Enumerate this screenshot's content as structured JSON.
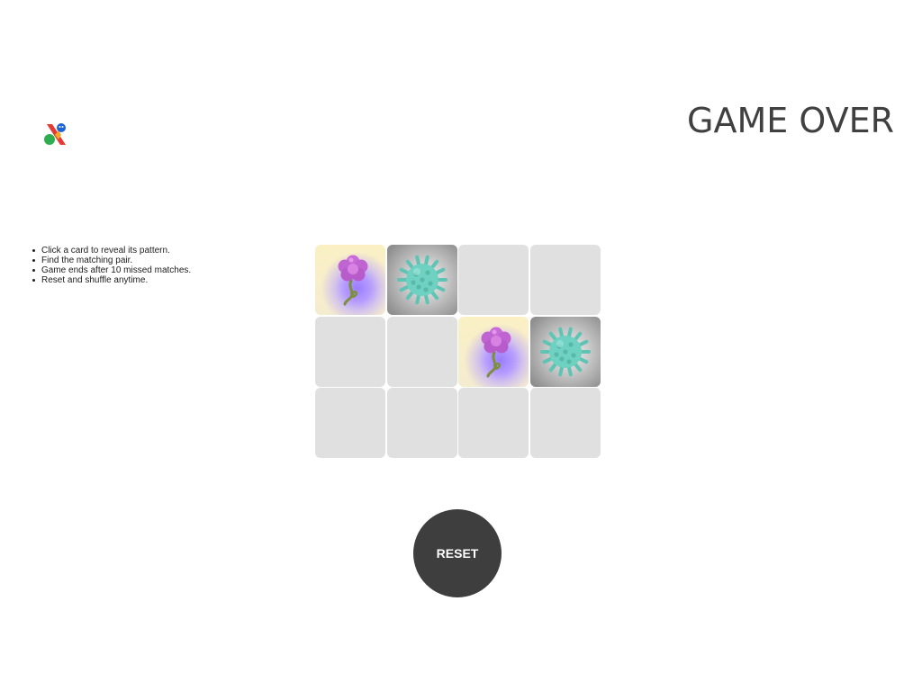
{
  "header": {
    "logo_icon": "app-logo-icon",
    "status_text": "GAME OVER"
  },
  "instructions": {
    "items": [
      "Click a card to reveal its pattern.",
      "Find the matching pair.",
      "Game ends after 10 missed matches.",
      "Reset and shuffle anytime."
    ]
  },
  "board": {
    "rows": 3,
    "columns": 4,
    "cards": [
      {
        "state": "revealed",
        "pattern": "flower-icon"
      },
      {
        "state": "revealed",
        "pattern": "virus-icon"
      },
      {
        "state": "hidden",
        "pattern": ""
      },
      {
        "state": "hidden",
        "pattern": ""
      },
      {
        "state": "hidden",
        "pattern": ""
      },
      {
        "state": "hidden",
        "pattern": ""
      },
      {
        "state": "revealed",
        "pattern": "flower-icon"
      },
      {
        "state": "revealed",
        "pattern": "virus-icon"
      },
      {
        "state": "hidden",
        "pattern": ""
      },
      {
        "state": "hidden",
        "pattern": ""
      },
      {
        "state": "hidden",
        "pattern": ""
      },
      {
        "state": "hidden",
        "pattern": ""
      }
    ]
  },
  "controls": {
    "reset_label": "RESET"
  },
  "colors": {
    "card_hidden": "#e0e0e0",
    "button_bg": "#3e3e3e",
    "status_text": "#404040",
    "flower_petals": "#c86ad8",
    "virus_body": "#6fd1c2"
  }
}
